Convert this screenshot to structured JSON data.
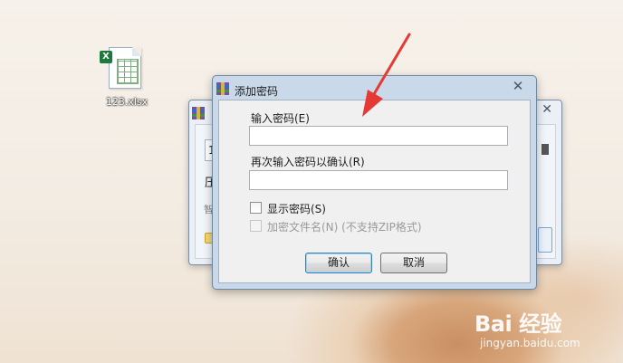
{
  "desktop": {
    "file_icon": {
      "label": "123.xlsx",
      "badge": "X",
      "icon": "excel-file-icon"
    }
  },
  "back_dialog": {
    "field_value": "1",
    "text1": "压",
    "text2": "智",
    "icon": "winrar-archive-icon",
    "close_icon": "close-icon"
  },
  "dialog": {
    "title": "添加密码",
    "title_icon": "winrar-archive-icon",
    "close_label": "✕",
    "password_label": "输入密码(E)",
    "password_value": "",
    "confirm_label": "再次输入密码以确认(R)",
    "confirm_value": "",
    "show_password_label": "显示密码(S)",
    "show_password_checked": false,
    "encrypt_names_label": "加密文件名(N) (不支持ZIP格式)",
    "encrypt_names_enabled": false,
    "ok_label": "确认",
    "cancel_label": "取消"
  },
  "annotation": {
    "arrow_color": "#e53935"
  },
  "watermark": {
    "brand": "Bai 经验",
    "url": "jingyan.baidu.com"
  }
}
